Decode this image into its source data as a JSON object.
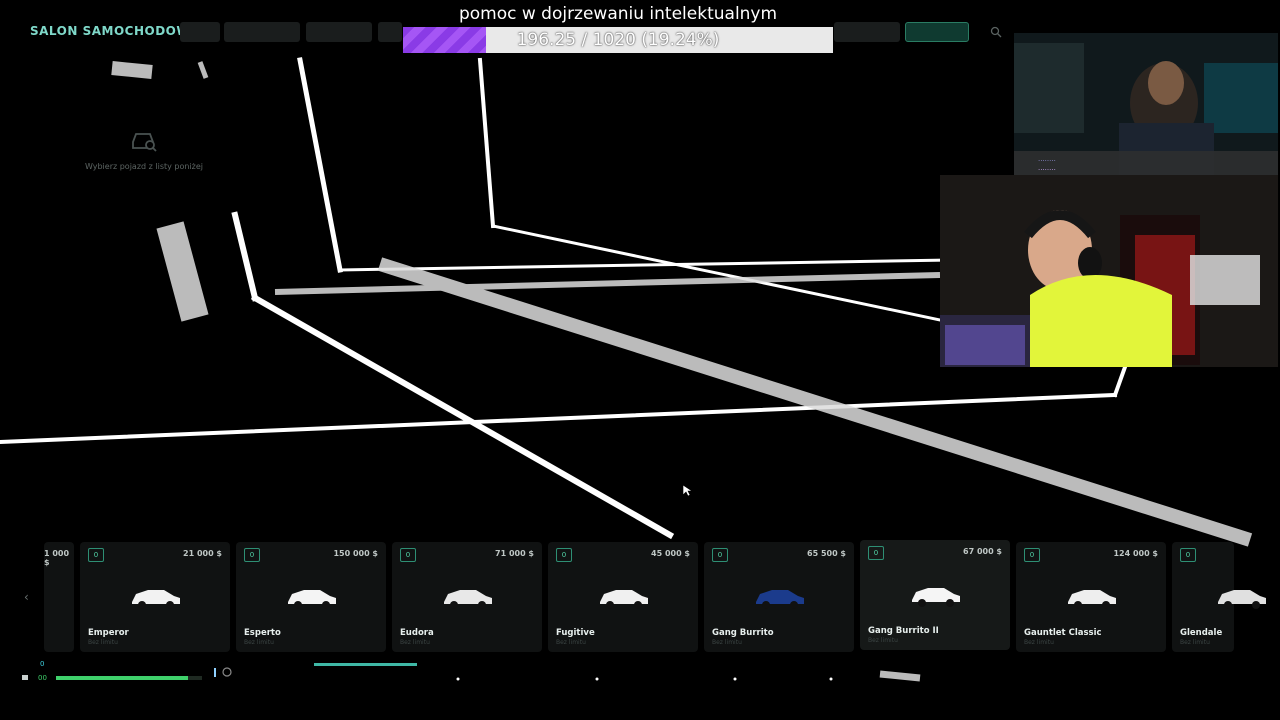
{
  "goal": {
    "title": "pomoc w dojrzewaniu intelektualnym",
    "progress_text": "196.25 / 1020 (19.24%)",
    "progress": 0.1924,
    "fill_color": "#8a3be6"
  },
  "salon": {
    "title": "SALON SAMOCHODOWY",
    "hint": "Wybierz pojazd z listy poniżej",
    "hint_icon": "car-search-icon"
  },
  "carousel": {
    "prev_icon": "chevron-left-icon",
    "next_icon": "chevron-right-icon",
    "partial_left_price": "1 000 $",
    "cards": [
      {
        "badge": "0",
        "price": "21 000 $",
        "name": "Emperor",
        "sub": "Bez limitu",
        "color": "#f2f2f2"
      },
      {
        "badge": "0",
        "price": "150 000 $",
        "name": "Esperto",
        "sub": "Bez limitu",
        "color": "#f4f4f4"
      },
      {
        "badge": "0",
        "price": "71 000 $",
        "name": "Eudora",
        "sub": "Bez limitu",
        "color": "#e8e8e8"
      },
      {
        "badge": "0",
        "price": "45 000 $",
        "name": "Fugitive",
        "sub": "Bez limitu",
        "color": "#f0f0f0"
      },
      {
        "badge": "0",
        "price": "65 500 $",
        "name": "Gang Burrito",
        "sub": "Bez limitu",
        "color": "#1b3b8c"
      },
      {
        "badge": "0",
        "price": "67 000 $",
        "name": "Gang Burrito II",
        "sub": "Bez limitu",
        "color": "#f5f5f5"
      },
      {
        "badge": "0",
        "price": "124 000 $",
        "name": "Gauntlet Classic",
        "sub": "Bez limitu",
        "color": "#eeeeee"
      },
      {
        "badge": "0",
        "price": "",
        "name": "Glendale",
        "sub": "Bez limitu",
        "color": "#e0e0e0"
      }
    ]
  },
  "hud": {
    "top_value": "0",
    "bottom_value": "00",
    "health_color": "#3fd16b"
  },
  "colors": {
    "accent": "#44d1a4",
    "card_bg": "#101212",
    "line": "#ffffff"
  }
}
